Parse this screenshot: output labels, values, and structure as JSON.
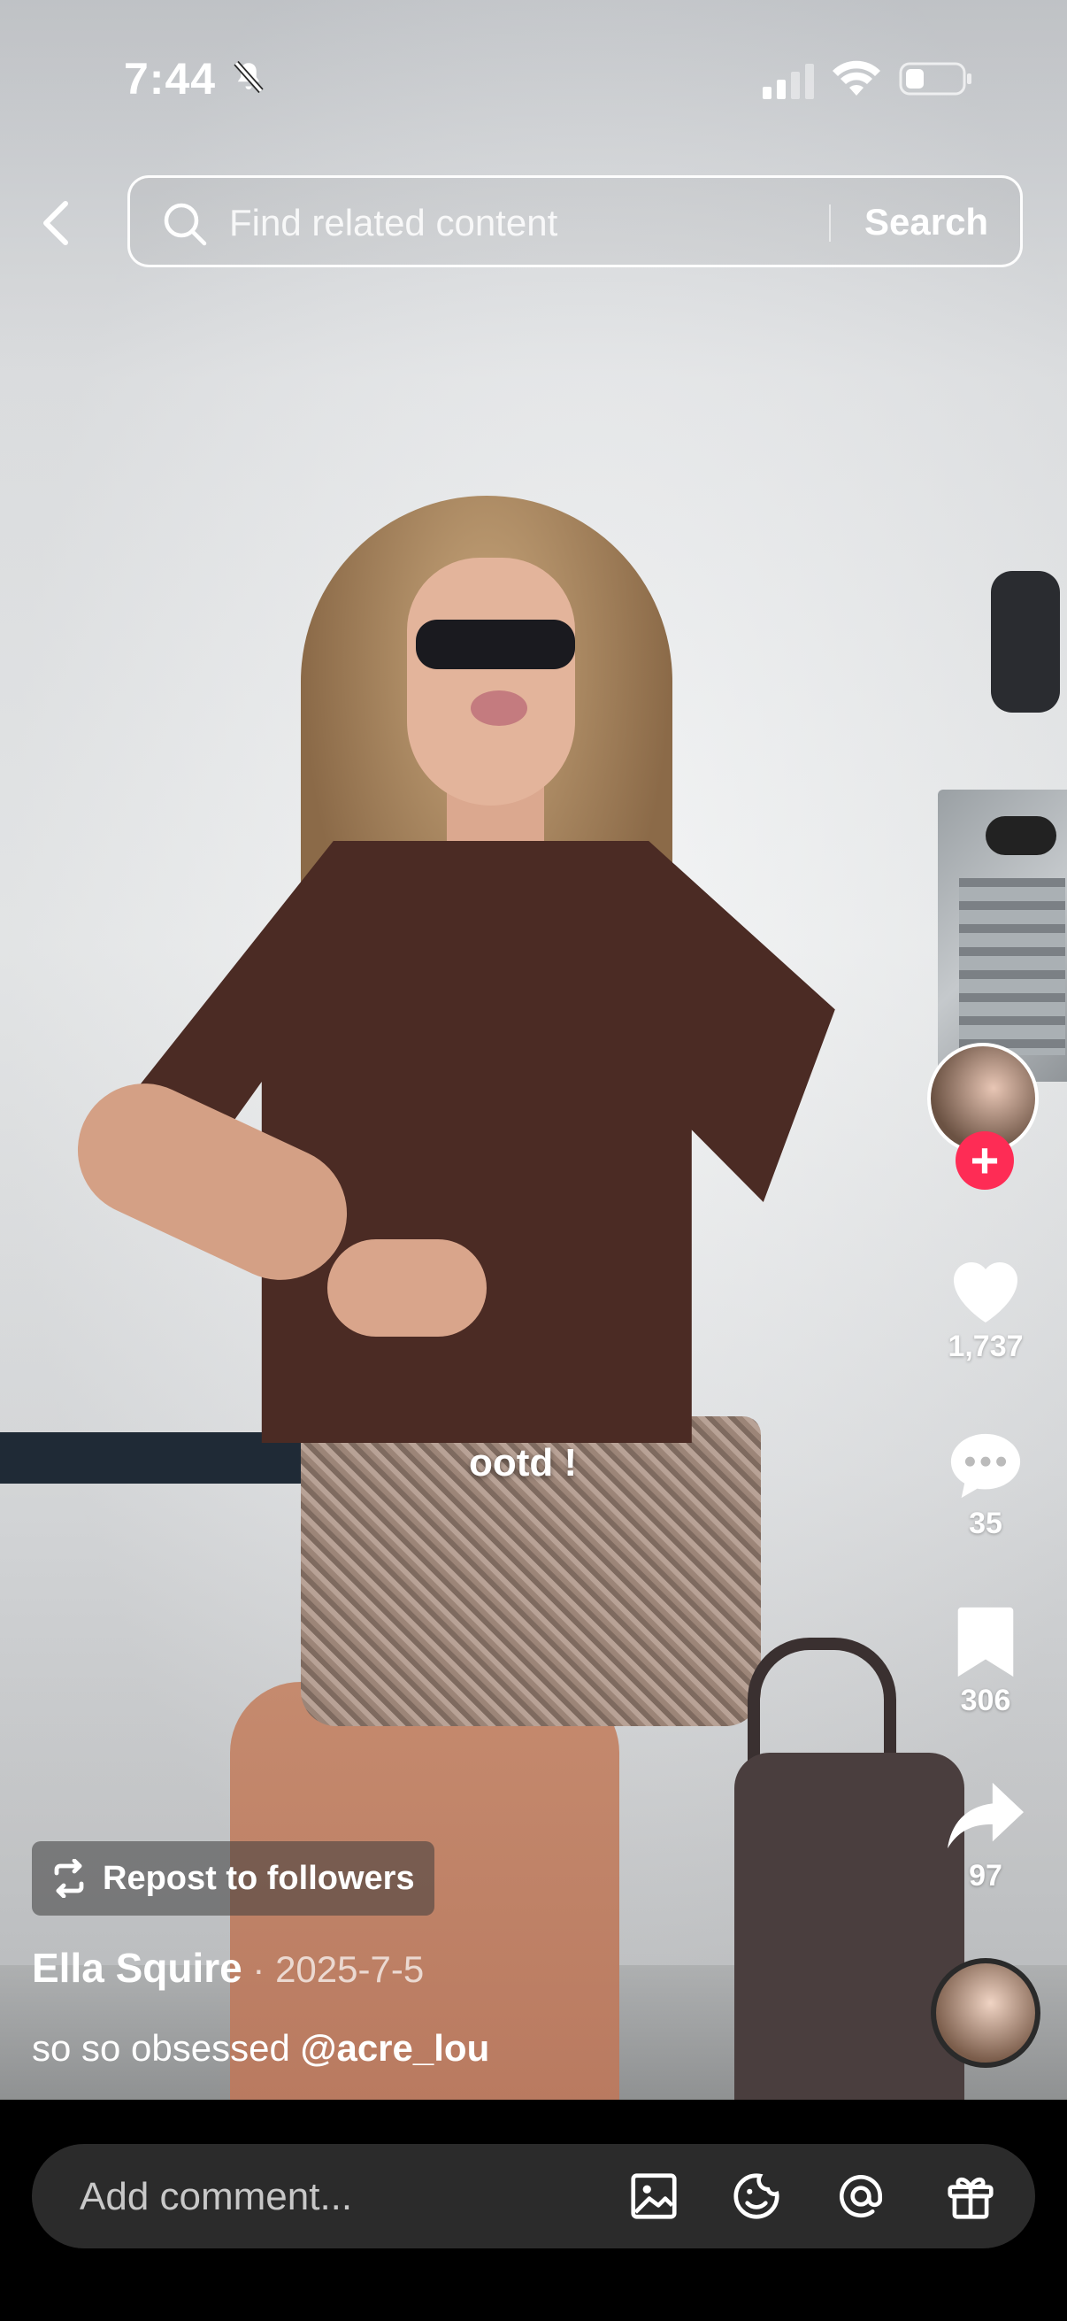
{
  "status_bar": {
    "time": "7:44"
  },
  "search": {
    "placeholder": "Find related content",
    "button_label": "Search"
  },
  "video": {
    "overlay_text": "ootd !"
  },
  "creator": {
    "follow_symbol": "+"
  },
  "actions": {
    "likes": "1,737",
    "comments": "35",
    "saves": "306",
    "shares": "97"
  },
  "repost": {
    "label": "Repost to followers"
  },
  "post": {
    "author": "Ella Squire",
    "date_separator": " · ",
    "date": "2025-7-5",
    "description": "so so obsessed ",
    "mention": "@acre_lou"
  },
  "comment_bar": {
    "placeholder": "Add comment..."
  },
  "colors": {
    "accent": "#fe2c55",
    "comment_bg": "#2b2b2b"
  }
}
